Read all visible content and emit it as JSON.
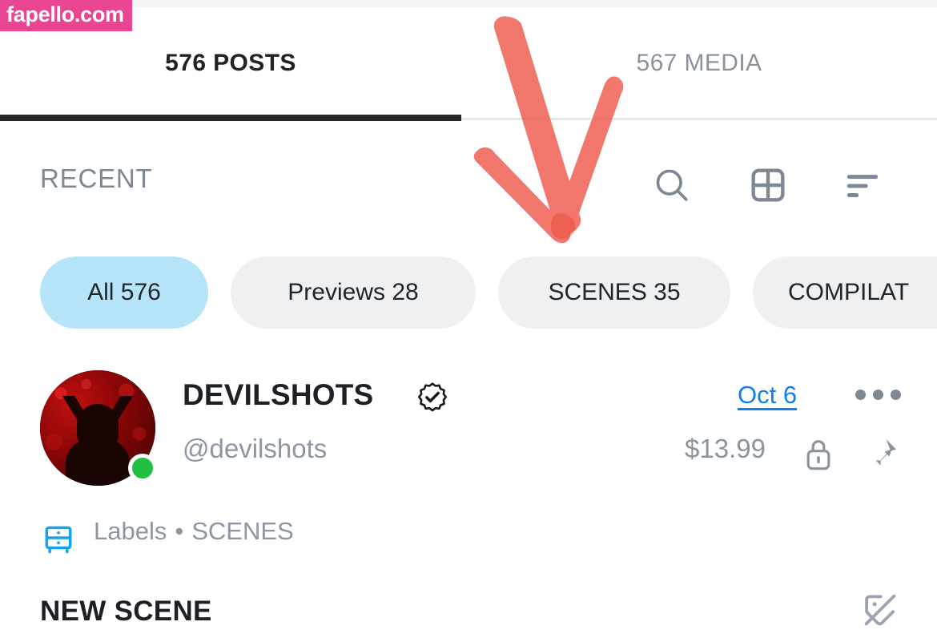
{
  "watermark": {
    "text": "fapello.com",
    "color": "#ea4593"
  },
  "tabs": [
    {
      "label": "576 POSTS",
      "count": 576,
      "name": "POSTS",
      "active": true
    },
    {
      "label": "567 MEDIA",
      "count": 567,
      "name": "MEDIA",
      "active": false
    }
  ],
  "toolbar": {
    "sort_label": "RECENT",
    "icons": [
      {
        "name": "search-icon",
        "label": "Search"
      },
      {
        "name": "grid-view-icon",
        "label": "Grid view"
      },
      {
        "name": "sort-icon",
        "label": "Sort"
      }
    ]
  },
  "filters": [
    {
      "label": "All 576",
      "selected": true
    },
    {
      "label": "Previews 28",
      "selected": false
    },
    {
      "label": "SCENES 35",
      "selected": false
    },
    {
      "label": "COMPILAT",
      "selected": false
    }
  ],
  "post": {
    "display_name": "DEVILSHOTS",
    "handle": "@devilshots",
    "verified": true,
    "online": true,
    "date": "Oct 6",
    "price": "$13.99",
    "locked": true,
    "pinned": true,
    "more_label": "More options",
    "labels_prefix": "Labels",
    "labels_separator": "•",
    "labels_value": "SCENES",
    "title": "NEW SCENE",
    "tag_icon_label": "tag-off"
  },
  "colors": {
    "accent_blue": "#0f7ef0",
    "chip_selected": "#b6e5fa",
    "chip_default": "#eef0f1",
    "muted_text": "#8d97a3",
    "dark_text": "#1d2125",
    "online_green": "#21c040",
    "annotation_red": "#ef5a4c",
    "watermark_pink": "#ea4593"
  }
}
